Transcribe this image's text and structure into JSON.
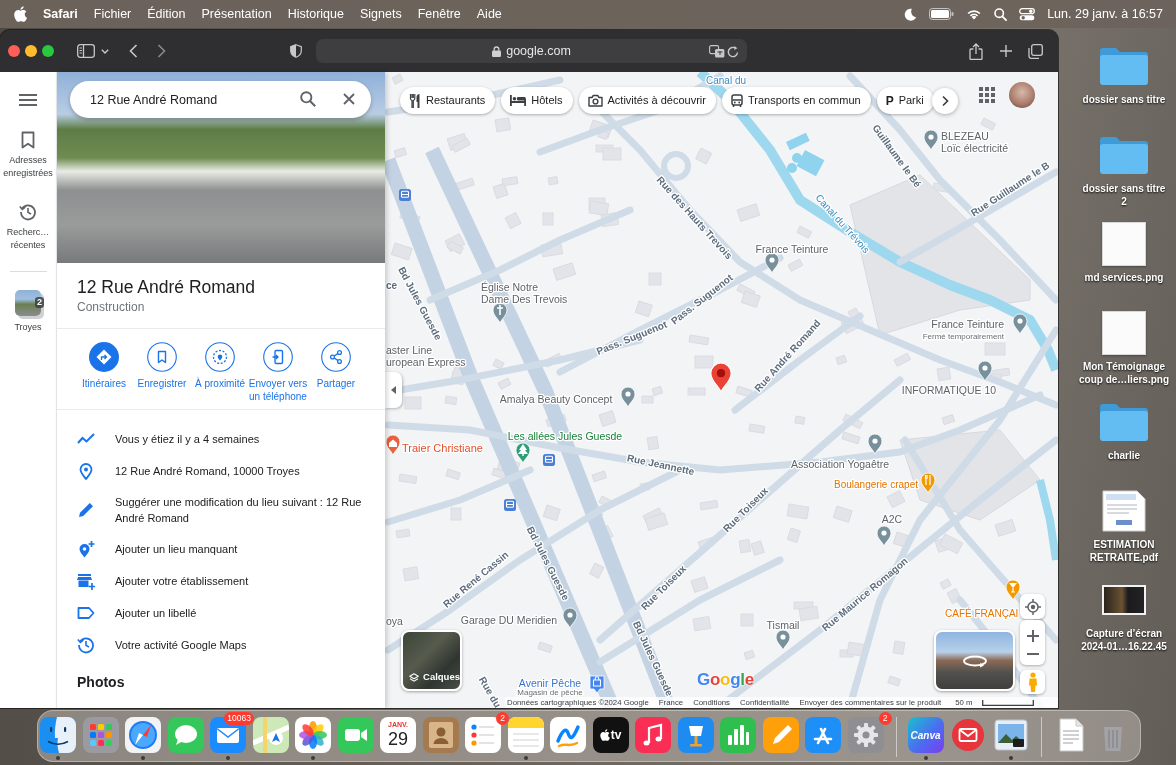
{
  "menu_bar": {
    "app": "Safari",
    "menus": [
      "Fichier",
      "Édition",
      "Présentation",
      "Historique",
      "Signets",
      "Fenêtre",
      "Aide"
    ],
    "clock": "Lun. 29 janv. à 16:57"
  },
  "browser": {
    "address": "google.com"
  },
  "maps": {
    "rail": [
      {
        "kind": "saved",
        "label_lines": [
          "Adresses",
          "enregistrées"
        ]
      },
      {
        "kind": "recent",
        "label_lines": [
          "Recherc…",
          "récentes"
        ]
      },
      {
        "kind": "place",
        "label_lines": [
          "Troyes"
        ],
        "badge": "2"
      }
    ],
    "search": {
      "value": "12 Rue André Romand"
    },
    "place": {
      "title": "12 Rue André Romand",
      "category": "Construction"
    },
    "actions": [
      {
        "kind": "directions",
        "filled": true,
        "label_lines": [
          "Itinéraires"
        ]
      },
      {
        "kind": "save",
        "filled": false,
        "label_lines": [
          "Enregistrer"
        ]
      },
      {
        "kind": "nearby",
        "filled": false,
        "label_lines": [
          "À proximité"
        ]
      },
      {
        "kind": "send",
        "filled": false,
        "label_lines": [
          "Envoyer vers",
          "un téléphone"
        ]
      },
      {
        "kind": "share",
        "filled": false,
        "label_lines": [
          "Partager"
        ]
      }
    ],
    "info_rows": [
      {
        "kind": "visited",
        "text": "Vous y étiez il y a 4 semaines"
      },
      {
        "kind": "address",
        "text": "12 Rue André Romand, 10000 Troyes"
      },
      {
        "kind": "edit",
        "text": "Suggérer une modification du lieu suivant : 12 Rue André Romand"
      },
      {
        "kind": "add_place",
        "text": "Ajouter un lieu manquant"
      },
      {
        "kind": "add_business",
        "text": "Ajouter votre établissement"
      },
      {
        "kind": "label",
        "text": "Ajouter un libellé"
      },
      {
        "kind": "activity",
        "text": "Votre activité Google Maps"
      }
    ],
    "photos_heading": "Photos",
    "chips": [
      {
        "kind": "restaurant",
        "label": "Restaurants"
      },
      {
        "kind": "hotel",
        "label": "Hôtels"
      },
      {
        "kind": "activity",
        "label": "Activités à découvrir"
      },
      {
        "kind": "transit",
        "label": "Transports en commun"
      },
      {
        "kind": "parking",
        "glyph": "P",
        "label": "Parki"
      }
    ],
    "map_labels": [
      {
        "kind": "water",
        "text": "Canal du"
      },
      {
        "kind": "place",
        "lines": [
          "BLEZEAU",
          "Loïc électricité"
        ]
      },
      {
        "kind": "street",
        "text": "Guillaume le Bé"
      },
      {
        "kind": "street",
        "text": "Rue Guillaume le B"
      },
      {
        "kind": "street",
        "text": "Rue des Hauts Trevois"
      },
      {
        "kind": "water",
        "text": "Canal du Trévois"
      },
      {
        "kind": "place",
        "text": "France Teinture"
      },
      {
        "kind": "place",
        "lines": [
          "Église Notre",
          "Dame Des Trevois"
        ]
      },
      {
        "kind": "street",
        "text": "Pass. Suguenot"
      },
      {
        "kind": "street",
        "text": "Pass. Suguenot"
      },
      {
        "kind": "place",
        "text": "France Teinture"
      },
      {
        "kind": "subtitle",
        "text": "Fermé temporairement"
      },
      {
        "kind": "street",
        "text": "Rue André Romand"
      },
      {
        "kind": "place",
        "lines": [
          "aster Line",
          "uropean Express"
        ]
      },
      {
        "kind": "place",
        "text": "INFORMATIQUE 10"
      },
      {
        "kind": "street",
        "text": "Bd Jules Guesde"
      },
      {
        "kind": "street",
        "text": "ce"
      },
      {
        "kind": "place",
        "text": "Amalya Beauty Concept"
      },
      {
        "kind": "park",
        "text": "Les allées Jules Guesde"
      },
      {
        "kind": "service",
        "text": "Traier Christiane"
      },
      {
        "kind": "street",
        "text": "Rue Jeannette"
      },
      {
        "kind": "place",
        "text": "Association Yogaêtre"
      },
      {
        "kind": "food",
        "text": "Boulangerie crapet"
      },
      {
        "kind": "street",
        "text": "Rue Toiseux"
      },
      {
        "kind": "place",
        "text": "A2C"
      },
      {
        "kind": "street",
        "text": "Rue René Cassin"
      },
      {
        "kind": "street",
        "text": "Bd Jules Guesde"
      },
      {
        "kind": "street",
        "text": "Rue Toiseux"
      },
      {
        "kind": "food",
        "text": "CAFÉ FRANÇAI"
      },
      {
        "kind": "street",
        "text": "Rue Maurice Romagon"
      },
      {
        "kind": "place",
        "text": "oya"
      },
      {
        "kind": "place",
        "text": "Garage DU Meridien"
      },
      {
        "kind": "place",
        "text": "Tismail"
      },
      {
        "kind": "street",
        "text": "Bd Jules Guesde"
      },
      {
        "kind": "street",
        "text": "Rue du"
      },
      {
        "kind": "shop",
        "text": "Avenir Pêche"
      },
      {
        "kind": "subtitle",
        "text": "Magasin de pêche"
      }
    ],
    "layers_label": "Calques",
    "logo": "Google",
    "footer": [
      "Données cartographiques ©2024 Google",
      "France",
      "Conditions",
      "Confidentialité",
      "Envoyer des commentaires sur le produit"
    ],
    "scale": "50 m"
  },
  "desktop_items": [
    {
      "kind": "folder",
      "label_lines": [
        "dossier sans titre"
      ]
    },
    {
      "kind": "folder",
      "label_lines": [
        "dossier sans titre",
        "2"
      ]
    },
    {
      "kind": "image",
      "label_lines": [
        "md services.png"
      ]
    },
    {
      "kind": "image",
      "label_lines": [
        "Mon Témoignage",
        "coup de…liers.png"
      ]
    },
    {
      "kind": "folder",
      "label_lines": [
        "charlie"
      ]
    },
    {
      "kind": "document",
      "label_lines": [
        "ESTIMATION",
        "RETRAITE.pdf"
      ]
    },
    {
      "kind": "screenshot",
      "label_lines": [
        "Capture d’écran",
        "2024-01…16.22.45"
      ]
    }
  ],
  "dock": {
    "apps": [
      {
        "kind": "finder",
        "running": true
      },
      {
        "kind": "launchpad",
        "running": false
      },
      {
        "kind": "safari",
        "running": true
      },
      {
        "kind": "messages",
        "running": false
      },
      {
        "kind": "mail",
        "running": true,
        "badge": "10063"
      },
      {
        "kind": "maps",
        "running": false
      },
      {
        "kind": "photos",
        "running": true
      },
      {
        "kind": "facetime",
        "running": false
      },
      {
        "kind": "calendar",
        "running": false,
        "month": "JANV.",
        "day": "29"
      },
      {
        "kind": "contacts",
        "running": false
      },
      {
        "kind": "reminders",
        "running": false,
        "badge": "2"
      },
      {
        "kind": "notes",
        "running": true
      },
      {
        "kind": "freeform",
        "running": false
      },
      {
        "kind": "tv",
        "running": false,
        "label": "tv"
      },
      {
        "kind": "music",
        "running": false
      },
      {
        "kind": "keynote",
        "running": false
      },
      {
        "kind": "numbers",
        "running": false
      },
      {
        "kind": "pages",
        "running": false
      },
      {
        "kind": "app_store",
        "running": false
      },
      {
        "kind": "settings",
        "running": false,
        "badge": "2"
      }
    ],
    "recent": [
      {
        "kind": "canva",
        "running": true,
        "label": "Canva"
      },
      {
        "kind": "mail_alt",
        "running": false
      },
      {
        "kind": "preview",
        "running": true
      }
    ],
    "others": [
      {
        "kind": "document"
      },
      {
        "kind": "trash"
      }
    ]
  }
}
